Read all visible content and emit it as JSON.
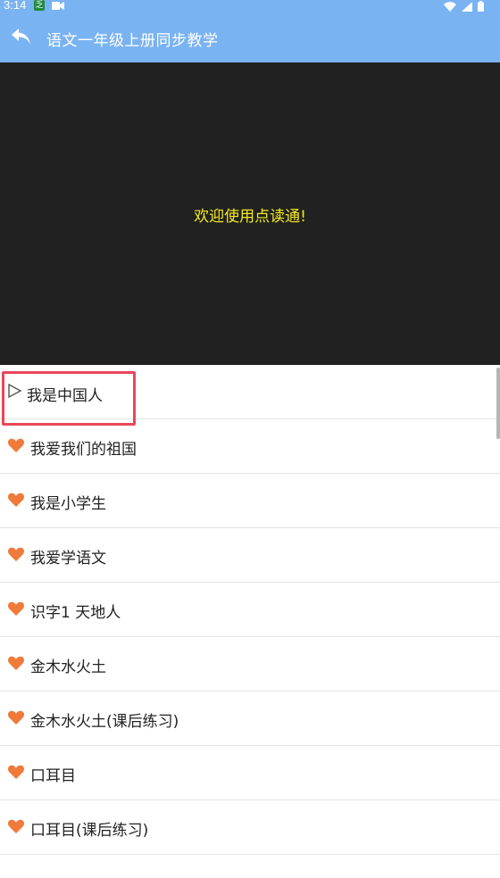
{
  "status_bar": {
    "time": "3:14",
    "app_icon_glyph": "乏",
    "icons": [
      "app-notification-icon",
      "camera-icon",
      "wifi-icon",
      "signal-icon",
      "battery-icon"
    ]
  },
  "app_bar": {
    "title": "语文一年级上册同步教学",
    "back_icon": "back-arrow-icon",
    "background": "#7ab3f2"
  },
  "player": {
    "welcome_text": "欢迎使用点读通!",
    "background": "#212121",
    "text_color": "#f2ea20"
  },
  "lessons": {
    "items": [
      {
        "label": "我是中国人",
        "icon": "play-outline-icon",
        "active": true
      },
      {
        "label": "我爱我们的祖国",
        "icon": "heart-icon",
        "active": false
      },
      {
        "label": "我是小学生",
        "icon": "heart-icon",
        "active": false
      },
      {
        "label": "我爱学语文",
        "icon": "heart-icon",
        "active": false
      },
      {
        "label": "识字1 天地人",
        "icon": "heart-icon",
        "active": false
      },
      {
        "label": "金木水火土",
        "icon": "heart-icon",
        "active": false
      },
      {
        "label": "金木水火土(课后练习)",
        "icon": "heart-icon",
        "active": false
      },
      {
        "label": "口耳目",
        "icon": "heart-icon",
        "active": false
      },
      {
        "label": "口耳目(课后练习)",
        "icon": "heart-icon",
        "active": false
      }
    ],
    "heart_color": "#f07a3a",
    "highlight_color": "#e8475a"
  }
}
